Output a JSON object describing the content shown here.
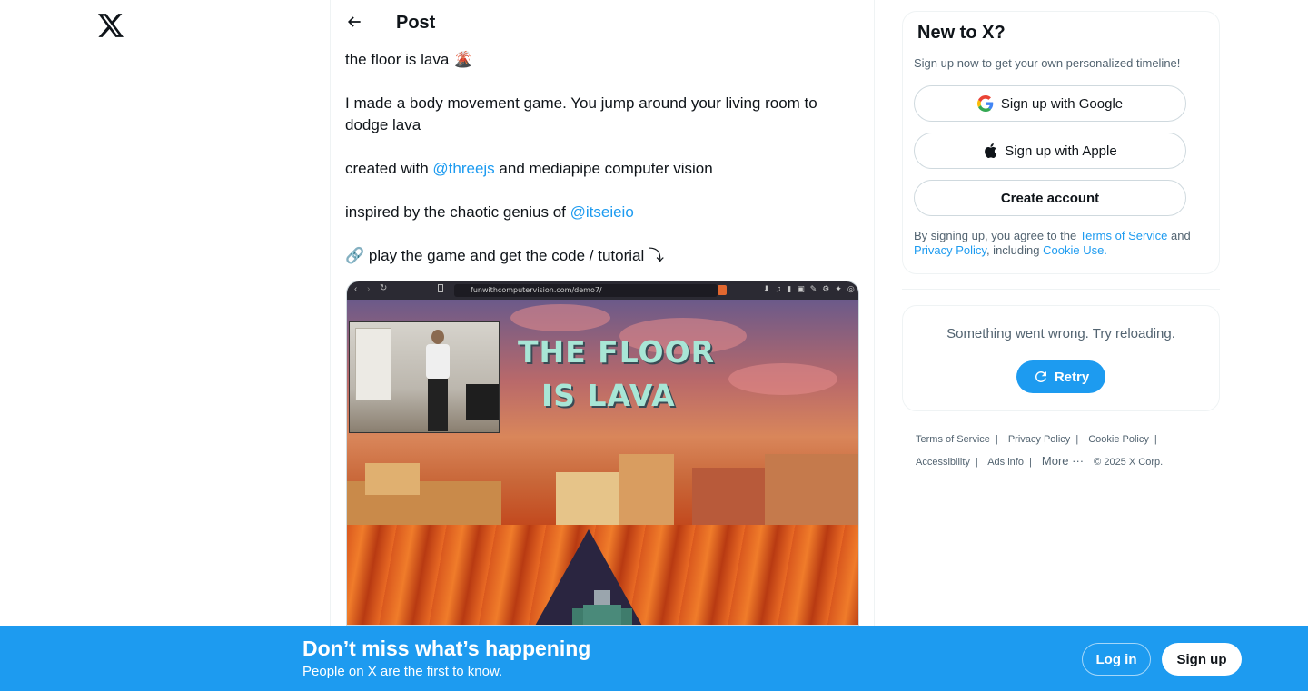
{
  "header": {
    "title": "Post"
  },
  "post": {
    "line1": "the floor is lava 🌋",
    "line2": "I made a body movement game. You jump around your living room to dodge lava",
    "line3_prefix": "created with ",
    "line3_mention": "@threejs",
    "line3_suffix": " and mediapipe computer vision",
    "line4_prefix": "inspired by the chaotic genius of ",
    "line4_mention": "@itseieio",
    "line5": "🔗 play the game and get the code / tutorial ⤵"
  },
  "media": {
    "browser_url": "funwithcomputervision.com/demo7/",
    "game_title_line1": "THE FLOOR",
    "game_title_line2": "IS LAVA"
  },
  "signup": {
    "heading": "New to X?",
    "subtext": "Sign up now to get your own personalized timeline!",
    "google_label": "Sign up with Google",
    "apple_label": "Sign up with Apple",
    "create_label": "Create account",
    "terms_prefix": "By signing up, you agree to the ",
    "terms_link": "Terms of Service",
    "terms_and": " and ",
    "privacy_link": "Privacy Policy",
    "terms_including": ", including ",
    "cookie_link": "Cookie Use."
  },
  "error_card": {
    "message": "Something went wrong. Try reloading.",
    "retry_label": "Retry"
  },
  "footer": {
    "terms": "Terms of Service",
    "privacy": "Privacy Policy",
    "cookie": "Cookie Policy",
    "accessibility": "Accessibility",
    "ads": "Ads info",
    "more": "More ···",
    "copyright": "© 2025 X Corp."
  },
  "banner": {
    "title": "Don’t miss what’s happening",
    "subtitle": "People on X are the first to know.",
    "login_label": "Log in",
    "signup_label": "Sign up"
  },
  "colors": {
    "accent": "#1d9bf0",
    "text": "#0f1419",
    "muted": "#536471"
  }
}
